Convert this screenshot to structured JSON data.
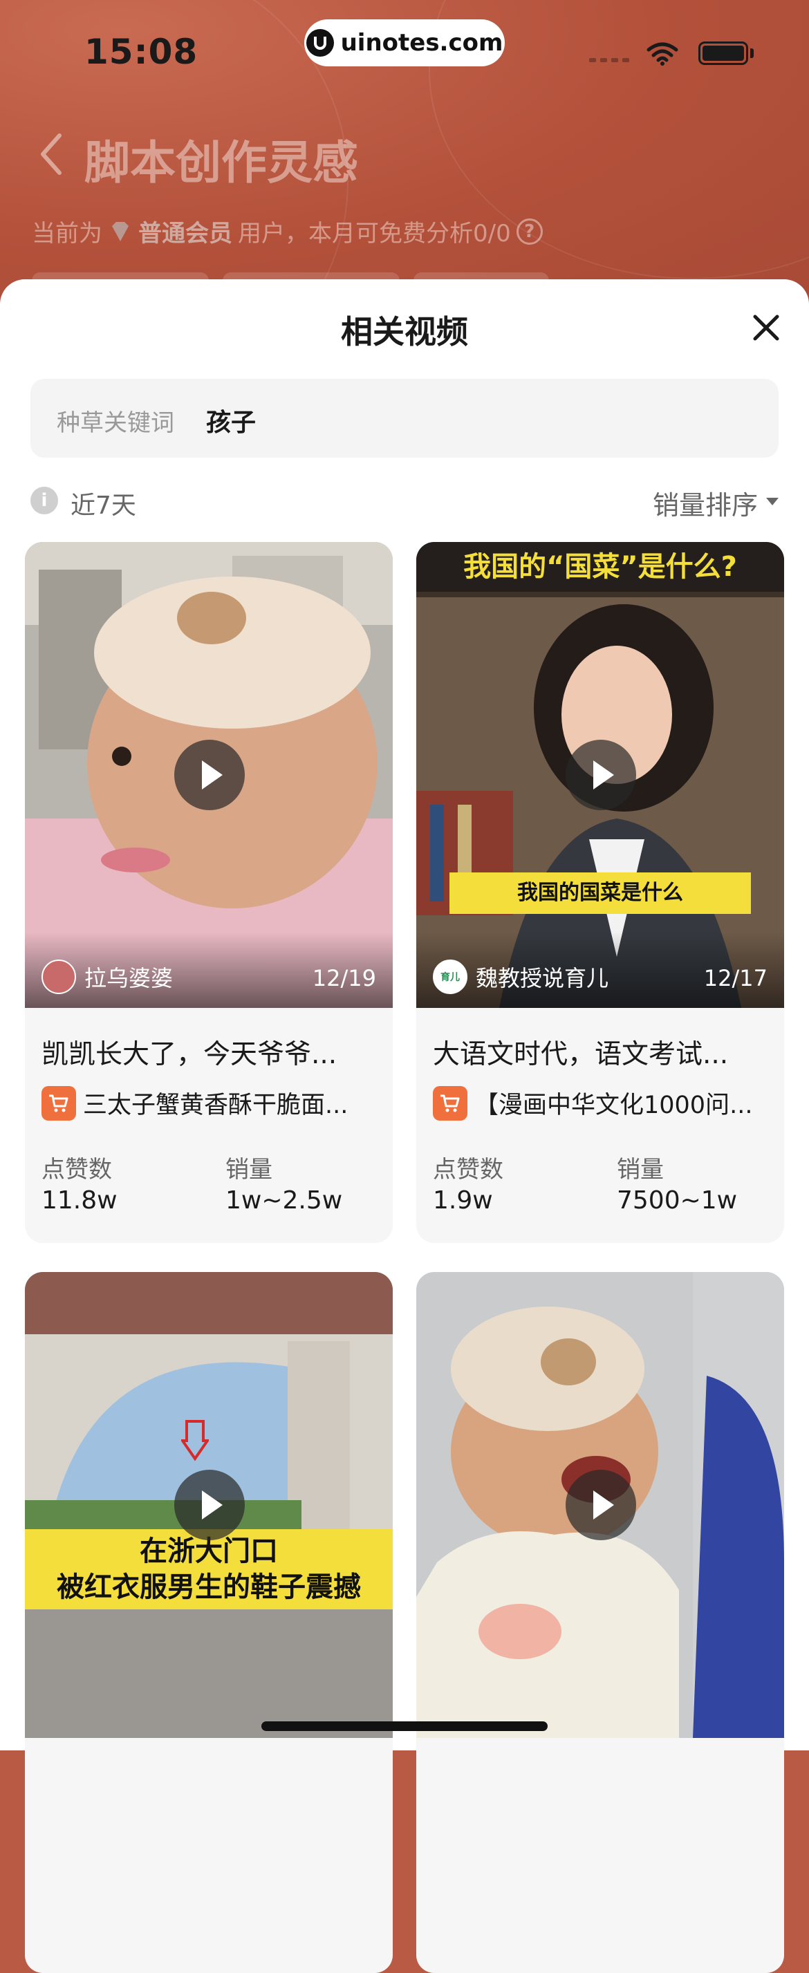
{
  "status_bar": {
    "time": "15:08",
    "url": "uinotes.com"
  },
  "header": {
    "title": "脚本创作灵感",
    "member_prefix": "当前为",
    "member_level": "普通会员",
    "member_suffix": "用户，本月可免费分析0/0",
    "help_glyph": "?"
  },
  "sheet": {
    "title": "相关视频",
    "search": {
      "label": "种草关键词",
      "value": "孩子"
    },
    "filter": {
      "info_glyph": "i",
      "range": "近7天",
      "sort": "销量排序"
    },
    "stat_labels": {
      "likes": "点赞数",
      "sales": "销量"
    },
    "videos": [
      {
        "author": "拉乌婆婆",
        "date": "12/19",
        "title": "凯凯长大了，今天爷爷...",
        "product": "三太子蟹黄香酥干脆面...",
        "likes": "11.8w",
        "sales": "1w~2.5w"
      },
      {
        "author": "魏教授说育儿",
        "date": "12/17",
        "title": "大语文时代，语文考试...",
        "product": "【漫画中华文化1000问...",
        "likes": "1.9w",
        "sales": "7500~1w",
        "caption_top": "我国的“国菜”是什么?",
        "caption_bottom": "我国的国菜是什么",
        "logo_text": "育儿"
      },
      {
        "caption_line1": "在浙大门口",
        "caption_line2": "被红衣服男生的鞋子震撼"
      },
      {}
    ]
  },
  "colors": {
    "accent": "#f0703d",
    "header_bg": "#b95a44",
    "caption_yellow": "#f4de3c"
  },
  "icons": [
    "back-arrow-icon",
    "diamond-icon",
    "help-icon",
    "close-icon",
    "info-icon",
    "caret-down-icon",
    "play-icon",
    "cart-icon"
  ]
}
